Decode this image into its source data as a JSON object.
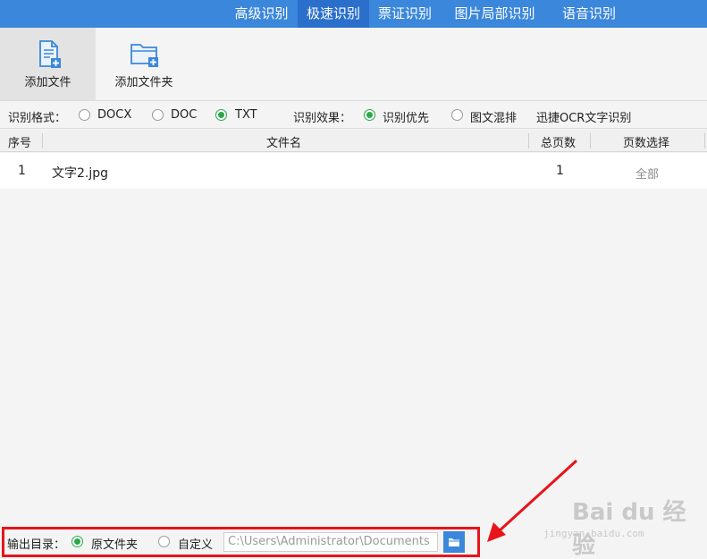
{
  "tabs": [
    "高级识别",
    "极速识别",
    "票证识别",
    "图片局部识别",
    "语音识别"
  ],
  "toolbar": {
    "add_file": "添加文件",
    "add_folder": "添加文件夹"
  },
  "options": {
    "format_label": "识别格式：",
    "formats": [
      "DOCX",
      "DOC",
      "TXT"
    ],
    "selected_format": "TXT",
    "effect_label": "识别效果：",
    "effects": [
      "识别优先",
      "图文混排"
    ],
    "selected_effect": "识别优先",
    "ocr_text": "迅捷OCR文字识别"
  },
  "table": {
    "columns": [
      "序号",
      "文件名",
      "总页数",
      "页数选择"
    ],
    "rows": [
      {
        "index": "1",
        "filename": "文字2.jpg",
        "pages": "1",
        "selection": "全部"
      }
    ]
  },
  "output": {
    "label": "输出目录：",
    "option_original": "原文件夹",
    "option_custom": "自定义",
    "selected": "原文件夹",
    "path": "C:\\Users\\Administrator\\Documents"
  },
  "watermark": {
    "brand": "Bai du 经验",
    "url": "jingyan.baidu.com"
  },
  "colors": {
    "accent": "#3b87db",
    "tab_active": "#2a6fcc",
    "radio_selected": "#2aa84a",
    "annotation": "#e8141b"
  }
}
